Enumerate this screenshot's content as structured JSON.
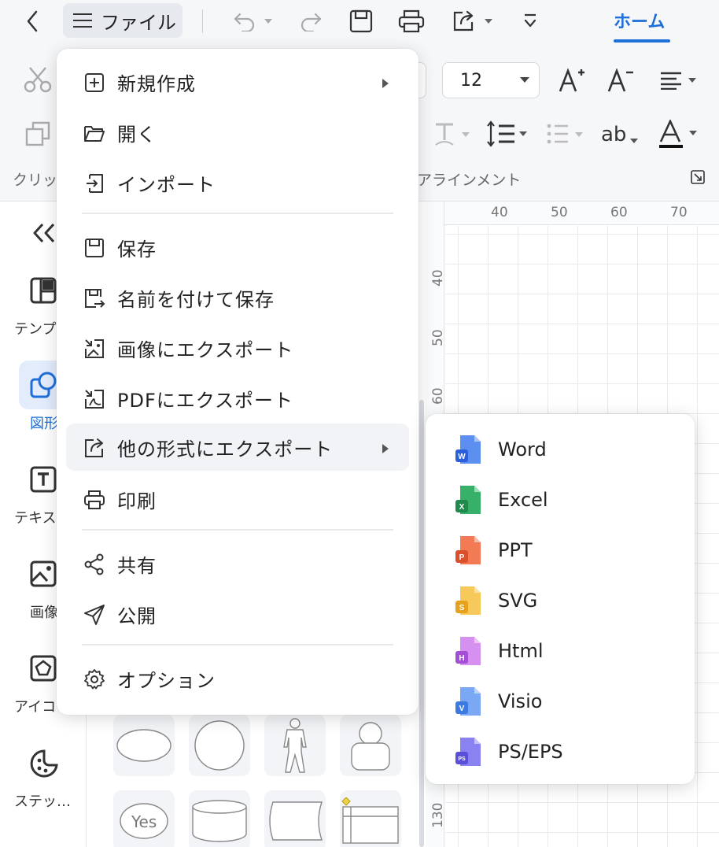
{
  "topbar": {
    "file_label": "ファイル",
    "home_tab": "ホーム"
  },
  "ribbon": {
    "font_size": "12",
    "clipboard_label": "クリッ",
    "alignment_label": "アラインメント",
    "ab_label": "ab"
  },
  "ruler": {
    "h_ticks": [
      "40",
      "50",
      "60",
      "70"
    ],
    "v_ticks": [
      "40",
      "50",
      "60",
      "130"
    ]
  },
  "left_panel": {
    "items": [
      {
        "label": "テンプ",
        "icon": "template-icon"
      },
      {
        "label": "図形",
        "icon": "shapes-icon"
      },
      {
        "label": "テキス",
        "icon": "text-icon"
      },
      {
        "label": "画像",
        "icon": "image-icon"
      },
      {
        "label": "アイコ",
        "icon": "icon-library-icon"
      },
      {
        "label": "ステッ…",
        "icon": "sticker-icon"
      }
    ]
  },
  "shapes": {
    "yes_label": "Yes"
  },
  "file_menu": {
    "items": [
      {
        "label": "新規作成",
        "icon": "new-icon",
        "has_submenu": true
      },
      {
        "label": "開く",
        "icon": "folder-open-icon"
      },
      {
        "label": "インポート",
        "icon": "import-icon"
      },
      {
        "label": "保存",
        "icon": "save-icon"
      },
      {
        "label": "名前を付けて保存",
        "icon": "save-as-icon"
      },
      {
        "label": "画像にエクスポート",
        "icon": "export-image-icon"
      },
      {
        "label": "PDFにエクスポート",
        "icon": "export-pdf-icon"
      },
      {
        "label": "他の形式にエクスポート",
        "icon": "export-other-icon",
        "has_submenu": true,
        "active": true
      },
      {
        "label": "印刷",
        "icon": "print-icon"
      },
      {
        "label": "共有",
        "icon": "share-icon"
      },
      {
        "label": "公開",
        "icon": "publish-icon"
      },
      {
        "label": "オプション",
        "icon": "gear-icon"
      }
    ]
  },
  "export_submenu": {
    "items": [
      {
        "label": "Word",
        "badge": "W",
        "color": "#2b5fd9"
      },
      {
        "label": "Excel",
        "badge": "X",
        "color": "#1f8a4c"
      },
      {
        "label": "PPT",
        "badge": "P",
        "color": "#d9502b"
      },
      {
        "label": "SVG",
        "badge": "S",
        "color": "#e6a21c"
      },
      {
        "label": "Html",
        "badge": "H",
        "color": "#a54fd6"
      },
      {
        "label": "Visio",
        "badge": "V",
        "color": "#3b7be0"
      },
      {
        "label": "PS/EPS",
        "badge": "PS",
        "color": "#5a4fd9"
      }
    ]
  },
  "colors": {
    "accent": "#1e6fd9",
    "menu_active_bg": "#f1f3f7"
  }
}
